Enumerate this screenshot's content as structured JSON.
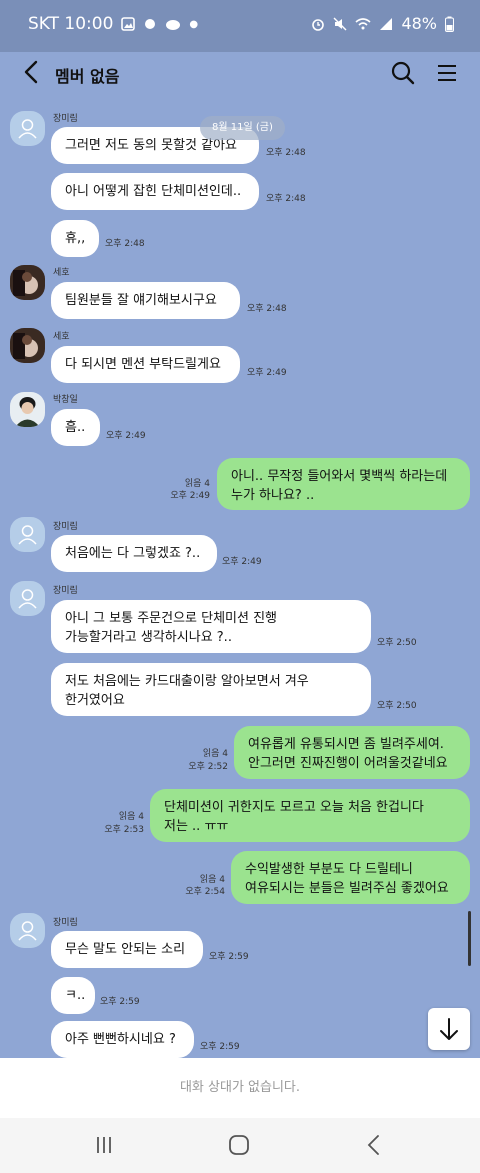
{
  "status_bar": {
    "carrier_time": "SKT 10:00",
    "battery": "48%"
  },
  "header": {
    "title": "멤버 없음"
  },
  "date_divider": "8월 11일 (금)",
  "messages": [
    {
      "sender": "장미림",
      "text": "그러면 저도 동의 못할것 같아요",
      "time": "오후 2:48"
    },
    {
      "text": "아니 어떻게 잡힌 단체미션인데..",
      "time": "오후 2:48"
    },
    {
      "text": "휴,,",
      "time": "오후 2:48"
    },
    {
      "sender": "세호",
      "text": "팀원분들 잘 얘기해보시구요",
      "time": "오후 2:48"
    },
    {
      "sender": "세호",
      "text": "다 되시면 멘션 부탁드릴게요",
      "time": "오후 2:49"
    },
    {
      "sender": "박창일",
      "text": "흠..",
      "time": "오후 2:49"
    },
    {
      "text": "아니.. 무작정 들어와서 몇백씩 하라는데\n누가 하나요? ..",
      "read": "읽음 4",
      "time": "오후 2:49"
    },
    {
      "sender": "장미림",
      "text": "처음에는 다 그렇겠죠 ?..",
      "time": "오후 2:49"
    },
    {
      "sender": "장미림",
      "text": "아니 그 보통 주문건으로 단체미션 진행\n가능할거라고 생각하시나요 ?..",
      "time": "오후 2:50"
    },
    {
      "text": "저도 처음에는 카드대출이랑 알아보면서 겨우\n한거였어요",
      "time": "오후 2:50"
    },
    {
      "text": "여유롭게 유통되시면 좀 빌려주세여.\n안그러면 진짜진행이 어려울것같네요",
      "read": "읽음 4",
      "time": "오후 2:52"
    },
    {
      "text": "단체미션이 귀한지도 모르고 오늘 처음 한겁니다\n저는 .. ㅠㅠ",
      "read": "읽음 4",
      "time": "오후 2:53"
    },
    {
      "text": "수익발생한 부분도 다 드릴테니\n여유되시는 분들은 빌려주심 좋겠어요",
      "read": "읽음 4",
      "time": "오후 2:54"
    },
    {
      "sender": "장미림",
      "text": "무슨 말도 안되는 소리",
      "time": "오후 2:59"
    },
    {
      "text": "ㅋ..",
      "time": "오후 2:59"
    },
    {
      "text": "아주 뻔뻔하시네요 ?",
      "time": "오후 2:59"
    }
  ],
  "footer": {
    "notice": "대화 상대가 없습니다."
  }
}
